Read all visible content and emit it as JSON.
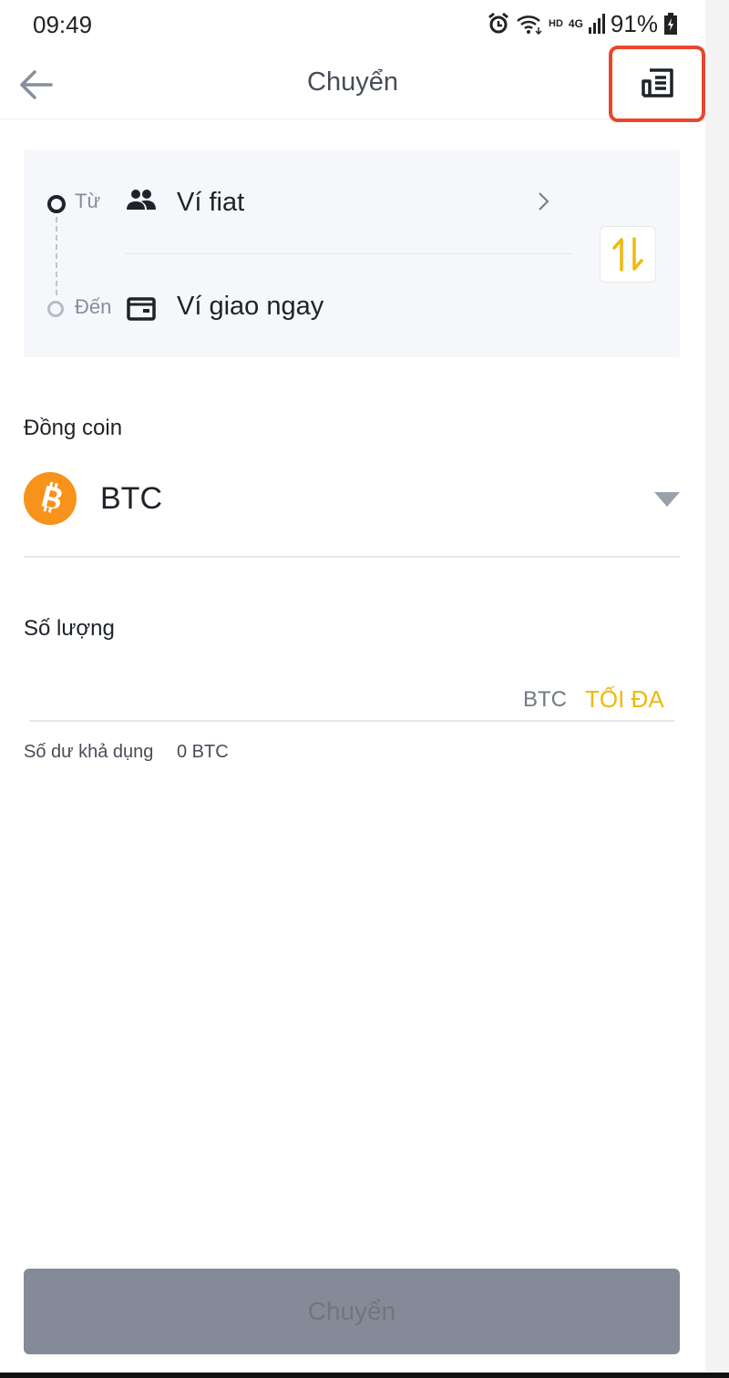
{
  "status_bar": {
    "time": "09:49",
    "hd": "HD",
    "network": "4G",
    "battery": "91%"
  },
  "header": {
    "title": "Chuyển",
    "back_icon": "arrow-left-icon",
    "history_icon": "transfer-history-icon"
  },
  "transfer": {
    "from_label": "Từ",
    "from_wallet": "Ví fiat",
    "to_label": "Đến",
    "to_wallet": "Ví giao ngay",
    "swap_icon": "swap-vertical-icon"
  },
  "coin": {
    "label": "Đồng coin",
    "selected": "BTC",
    "icon": "bitcoin-icon"
  },
  "amount": {
    "label": "Số lượng",
    "value": "",
    "unit": "BTC",
    "max_label": "TỐI ĐA",
    "balance_label": "Số dư khả dụng",
    "balance_value": "0  BTC"
  },
  "submit_label": "Chuyển",
  "colors": {
    "accent": "#f0b90b",
    "highlight_box": "#e8472c",
    "card_bg": "#f5f7fa",
    "button_disabled": "#858a99",
    "bitcoin": "#f7931a"
  }
}
